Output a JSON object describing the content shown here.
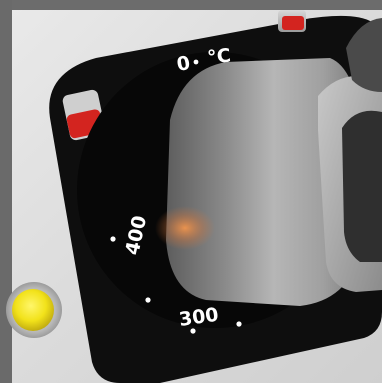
{
  "dial": {
    "scale_labels": [
      "0",
      "°C",
      "300",
      "400"
    ]
  },
  "indicator": {
    "lamp_color": "#f2e21a",
    "marker_color": "#d3241f"
  }
}
